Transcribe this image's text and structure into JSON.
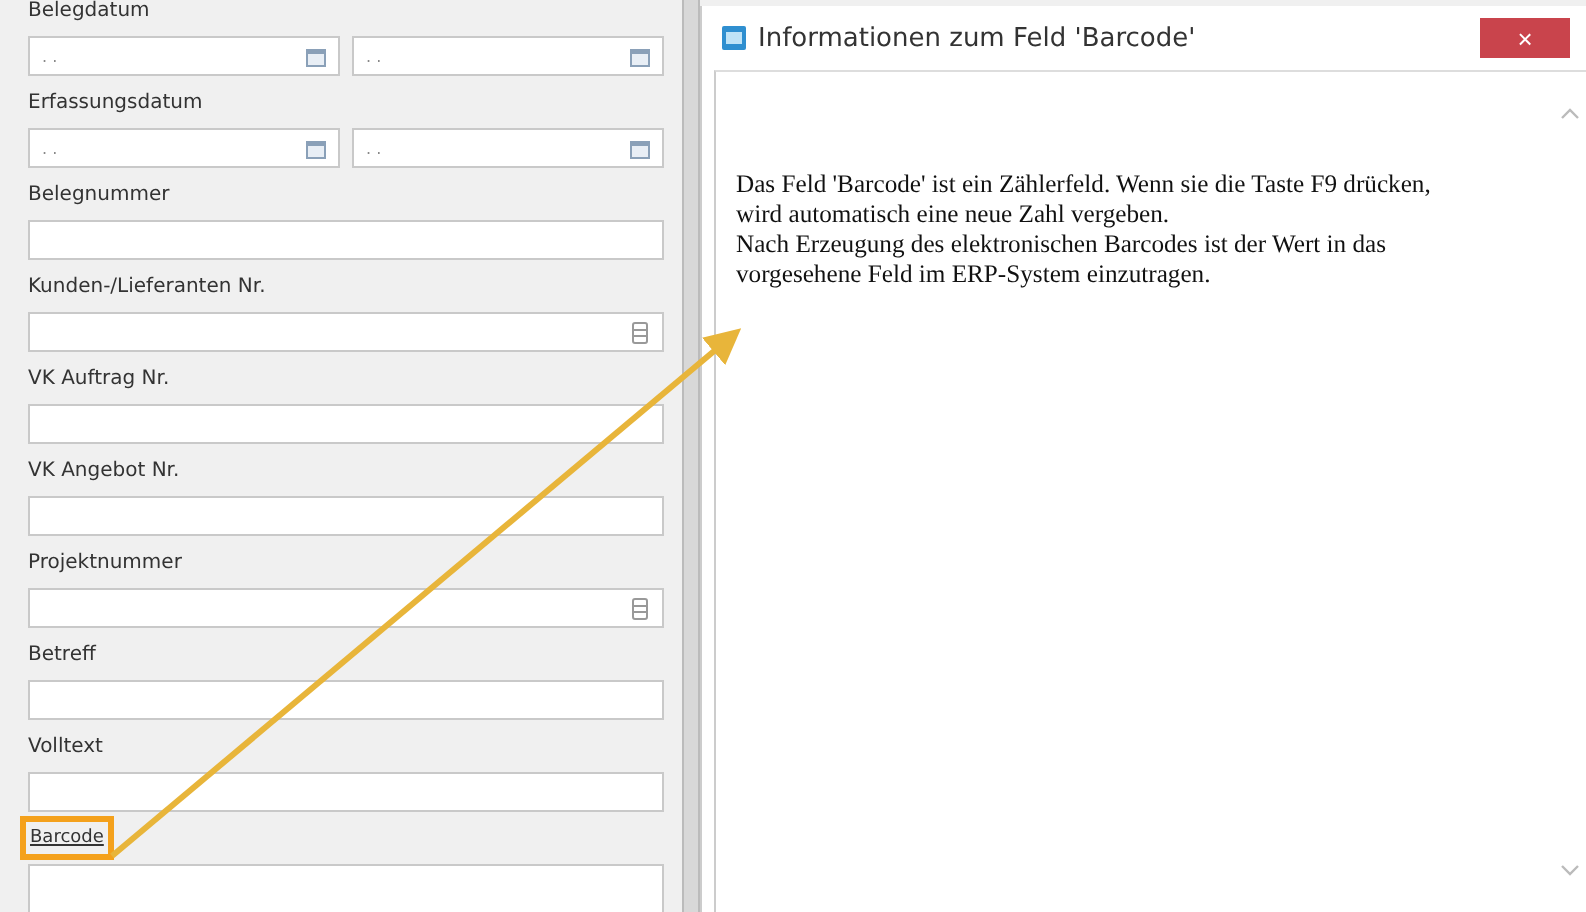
{
  "form": {
    "fields": [
      {
        "kind": "date_pair",
        "label": "Belegdatum",
        "values": [
          ". .",
          ". ."
        ]
      },
      {
        "kind": "date_pair",
        "label": "Erfassungsdatum",
        "values": [
          ". .",
          ". ."
        ]
      },
      {
        "kind": "text",
        "label": "Belegnummer"
      },
      {
        "kind": "lookup",
        "label": "Kunden-/Lieferanten Nr."
      },
      {
        "kind": "text",
        "label": "VK Auftrag Nr."
      },
      {
        "kind": "text",
        "label": "VK Angebot Nr."
      },
      {
        "kind": "lookup",
        "label": "Projektnummer"
      },
      {
        "kind": "text",
        "label": "Betreff"
      },
      {
        "kind": "text",
        "label": "Volltext"
      },
      {
        "kind": "link_text",
        "label": "Barcode",
        "highlighted": true
      }
    ]
  },
  "dialog": {
    "title": "Informationen zum Feld 'Barcode'",
    "close": "×",
    "lines": [
      "Das Feld 'Barcode' ist ein Zählerfeld. Wenn sie die Taste F9 drücken,",
      "wird automatisch eine neue Zahl vergeben.",
      "Nach Erzeugung des elektronischen Barcodes ist der Wert in das",
      "vorgesehene Feld im ERP-System einzutragen."
    ]
  }
}
